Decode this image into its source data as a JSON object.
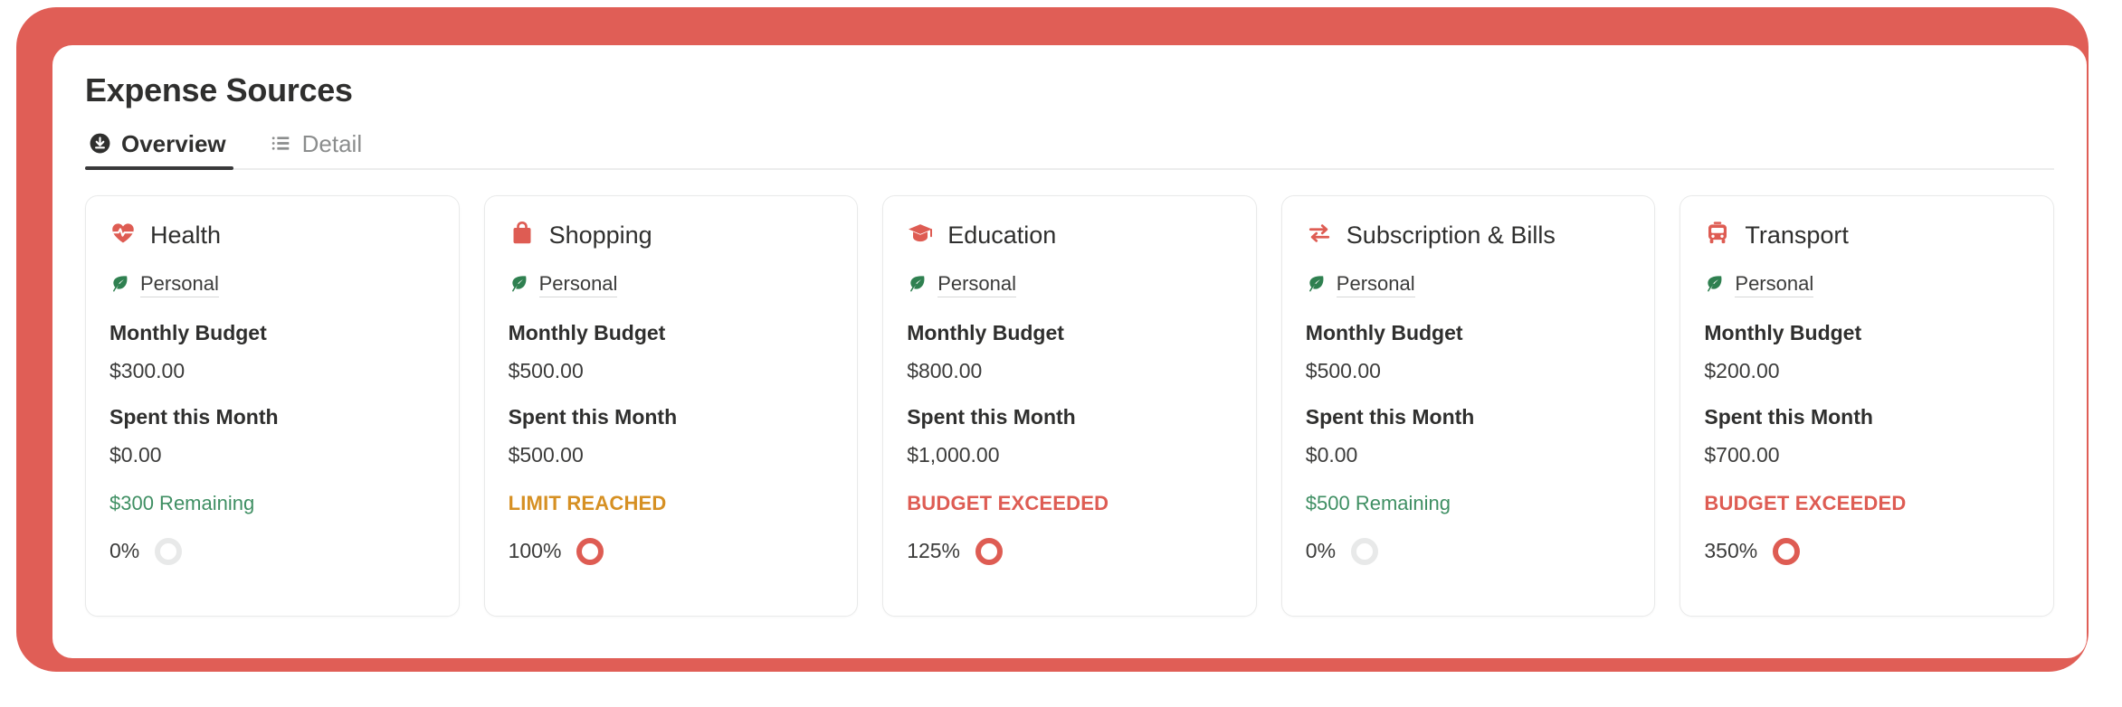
{
  "header": {
    "title": "Expense Sources"
  },
  "tabs": [
    {
      "label": "Overview",
      "icon": "download-circle-icon",
      "active": true
    },
    {
      "label": "Detail",
      "icon": "list-icon",
      "active": false
    }
  ],
  "labels": {
    "monthly_budget": "Monthly Budget",
    "spent_this_month": "Spent this Month",
    "owner": "Personal"
  },
  "colors": {
    "frame_red": "#e05e56",
    "accent_red": "#de5c53",
    "warning_amber": "#d69023",
    "success_green": "#3f8f63",
    "ring_empty": "#e8e9e9",
    "card_border": "#e9eaea",
    "text_dark": "#2f2f2e",
    "tab_inactive": "#8b8d8d"
  },
  "cards": [
    {
      "name": "Health",
      "icon": "heart-pulse-icon",
      "owner": "Personal",
      "owner_icon": "leaf-icon",
      "monthly_budget": "$300.00",
      "spent_this_month": "$0.00",
      "status_text": "$300 Remaining",
      "status_kind": "ok",
      "percent_label": "0%",
      "percent_value": 0
    },
    {
      "name": "Shopping",
      "icon": "shopping-bag-icon",
      "owner": "Personal",
      "owner_icon": "leaf-icon",
      "monthly_budget": "$500.00",
      "spent_this_month": "$500.00",
      "status_text": "LIMIT REACHED",
      "status_kind": "limit",
      "percent_label": "100%",
      "percent_value": 100
    },
    {
      "name": "Education",
      "icon": "graduation-cap-icon",
      "owner": "Personal",
      "owner_icon": "leaf-icon",
      "monthly_budget": "$800.00",
      "spent_this_month": "$1,000.00",
      "status_text": "BUDGET EXCEEDED",
      "status_kind": "over",
      "percent_label": "125%",
      "percent_value": 125
    },
    {
      "name": "Subscription & Bills",
      "icon": "recurring-arrows-icon",
      "owner": "Personal",
      "owner_icon": "leaf-icon",
      "monthly_budget": "$500.00",
      "spent_this_month": "$0.00",
      "status_text": "$500 Remaining",
      "status_kind": "ok",
      "percent_label": "0%",
      "percent_value": 0
    },
    {
      "name": "Transport",
      "icon": "bus-icon",
      "owner": "Personal",
      "owner_icon": "leaf-icon",
      "monthly_budget": "$200.00",
      "spent_this_month": "$700.00",
      "status_text": "BUDGET EXCEEDED",
      "status_kind": "over",
      "percent_label": "350%",
      "percent_value": 350
    }
  ]
}
